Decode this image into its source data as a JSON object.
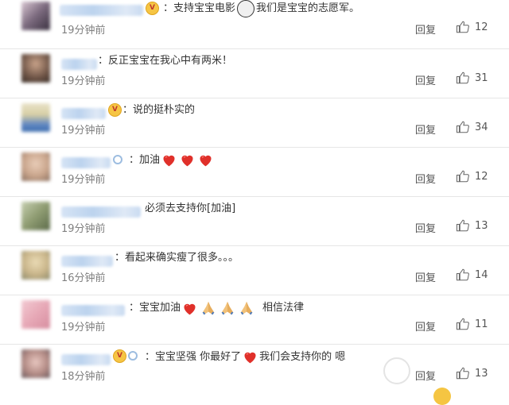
{
  "comments": [
    {
      "text": "：支持宝宝电影",
      "text2": "我们是宝宝的志愿军。",
      "time": "19分钟前",
      "reply": "回复",
      "likes": "12"
    },
    {
      "text": "：反正宝宝在我心中有两米！",
      "time": "19分钟前",
      "reply": "回复",
      "likes": "31"
    },
    {
      "text": "：说的挺朴实的",
      "time": "19分钟前",
      "reply": "回复",
      "likes": "34"
    },
    {
      "text": "：加油",
      "time": "19分钟前",
      "reply": "回复",
      "likes": "12"
    },
    {
      "text": "必须去支持你[加油]",
      "time": "19分钟前",
      "reply": "回复",
      "likes": "13"
    },
    {
      "text": "：看起来确实瘦了很多。。。",
      "time": "16分钟前",
      "reply": "回复",
      "likes": "14"
    },
    {
      "text": "：宝宝加油",
      "text2": "相信法律",
      "time": "19分钟前",
      "reply": "回复",
      "likes": "11"
    },
    {
      "text": "：宝宝坚强 你最好了",
      "text2": "我们会支持你的 嗯",
      "time": "18分钟前",
      "reply": "回复",
      "likes": "13"
    }
  ],
  "icons": {
    "like": "thumbs-up-icon",
    "heart": "red-heart-emoji",
    "pray": "praying-hands-emoji",
    "verified": "verified-badge-icon"
  },
  "colors": {
    "time": "#808080",
    "heart": "#e0302a",
    "divider": "#e6e6e6"
  }
}
